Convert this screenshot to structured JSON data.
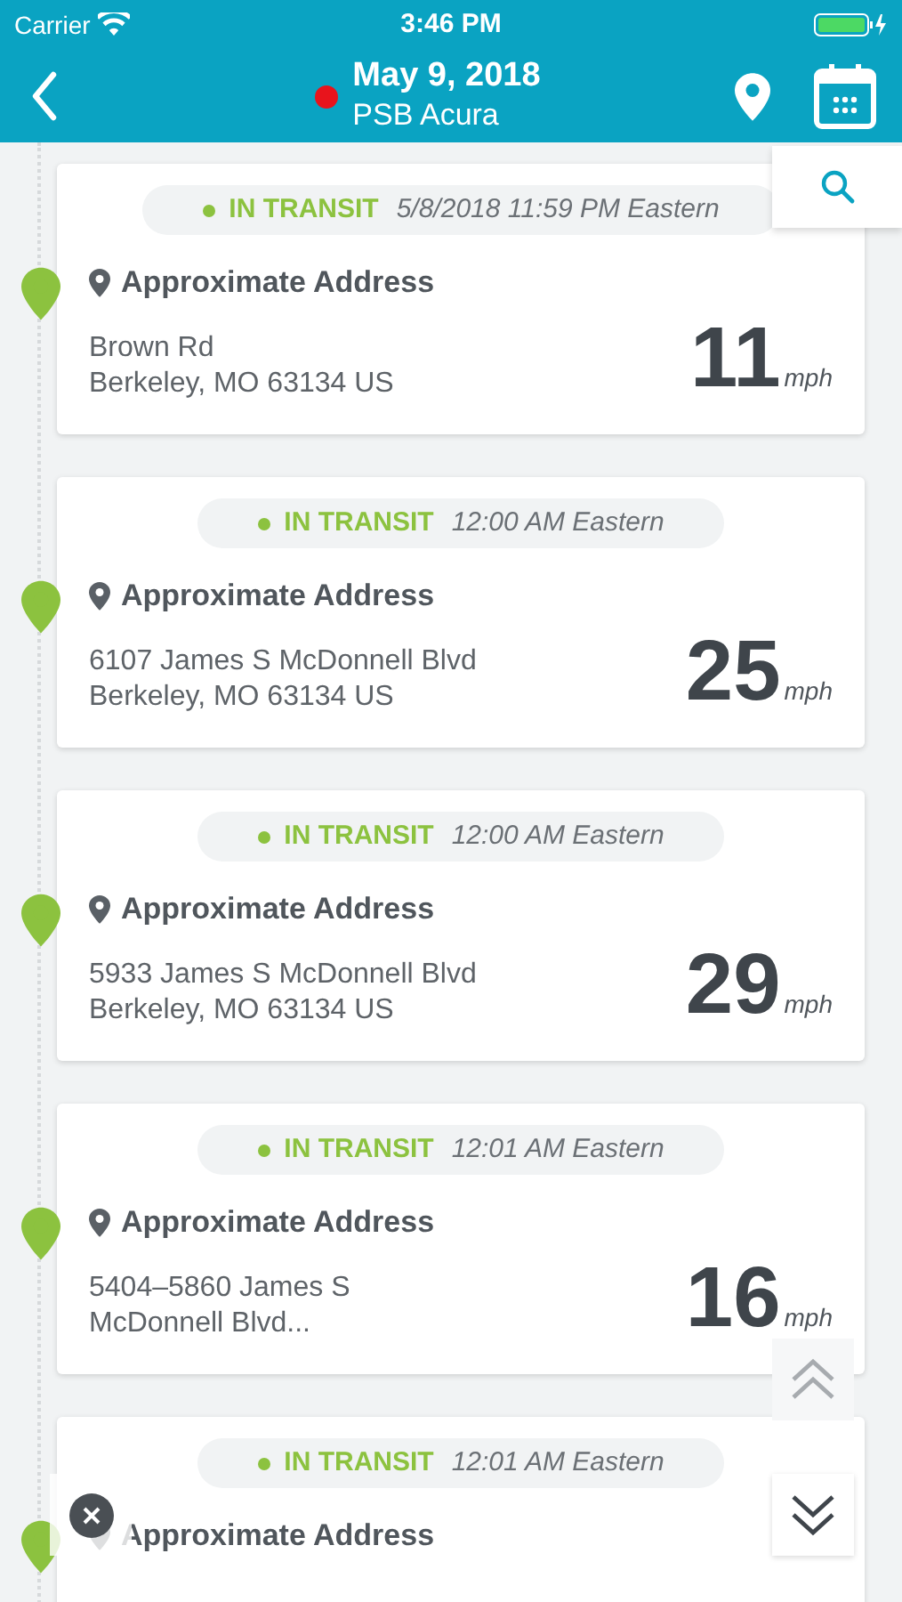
{
  "status_bar": {
    "carrier": "Carrier",
    "time": "3:46 PM"
  },
  "header": {
    "date": "May 9, 2018",
    "vehicle": "PSB Acura",
    "status_dot": {
      "color": "#e8141c"
    }
  },
  "events": [
    {
      "status": "IN TRANSIT",
      "time": "5/8/2018 11:59 PM Eastern",
      "address_label": "Approximate Address",
      "address_lines": [
        "Brown Rd",
        "Berkeley, MO 63134 US"
      ],
      "speed": "11",
      "unit": "mph"
    },
    {
      "status": "IN TRANSIT",
      "time": "12:00 AM Eastern",
      "address_label": "Approximate Address",
      "address_lines": [
        "6107 James S McDonnell Blvd",
        "Berkeley, MO 63134 US"
      ],
      "speed": "25",
      "unit": "mph"
    },
    {
      "status": "IN TRANSIT",
      "time": "12:00 AM Eastern",
      "address_label": "Approximate Address",
      "address_lines": [
        "5933 James S McDonnell Blvd",
        "Berkeley, MO 63134 US"
      ],
      "speed": "29",
      "unit": "mph"
    },
    {
      "status": "IN TRANSIT",
      "time": "12:01 AM Eastern",
      "address_label": "Approximate Address",
      "address_lines": [
        "5404–5860 James S",
        "McDonnell Blvd..."
      ],
      "speed": "16",
      "unit": "mph"
    },
    {
      "status": "IN TRANSIT",
      "time": "12:01 AM Eastern",
      "address_label": "Approximate Address"
    }
  ]
}
